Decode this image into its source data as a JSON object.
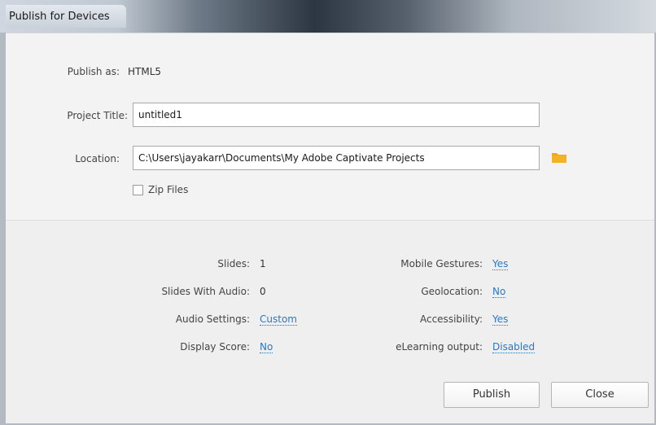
{
  "window": {
    "title": "Publish for Devices"
  },
  "publish_as": {
    "label": "Publish as:",
    "value": "HTML5"
  },
  "project_title": {
    "label": "Project Title:",
    "value": "untitled1"
  },
  "location": {
    "label": "Location:",
    "value": "C:\\Users\\jayakarr\\Documents\\My Adobe Captivate Projects"
  },
  "zip_files": {
    "label": "Zip Files",
    "checked": false
  },
  "summary": {
    "slides": {
      "label": "Slides:",
      "value": "1"
    },
    "slides_with_audio": {
      "label": "Slides With Audio:",
      "value": "0"
    },
    "audio_settings": {
      "label": "Audio Settings:",
      "value": "Custom"
    },
    "display_score": {
      "label": "Display Score:",
      "value": "No"
    },
    "mobile_gestures": {
      "label": "Mobile Gestures:",
      "value": "Yes"
    },
    "geolocation": {
      "label": "Geolocation:",
      "value": "No"
    },
    "accessibility": {
      "label": "Accessibility:",
      "value": "Yes"
    },
    "elearning_output": {
      "label": "eLearning output:",
      "value": "Disabled"
    }
  },
  "buttons": {
    "publish": "Publish",
    "close": "Close"
  },
  "colors": {
    "link": "#2b78c5",
    "folder": "#f0a81a"
  }
}
